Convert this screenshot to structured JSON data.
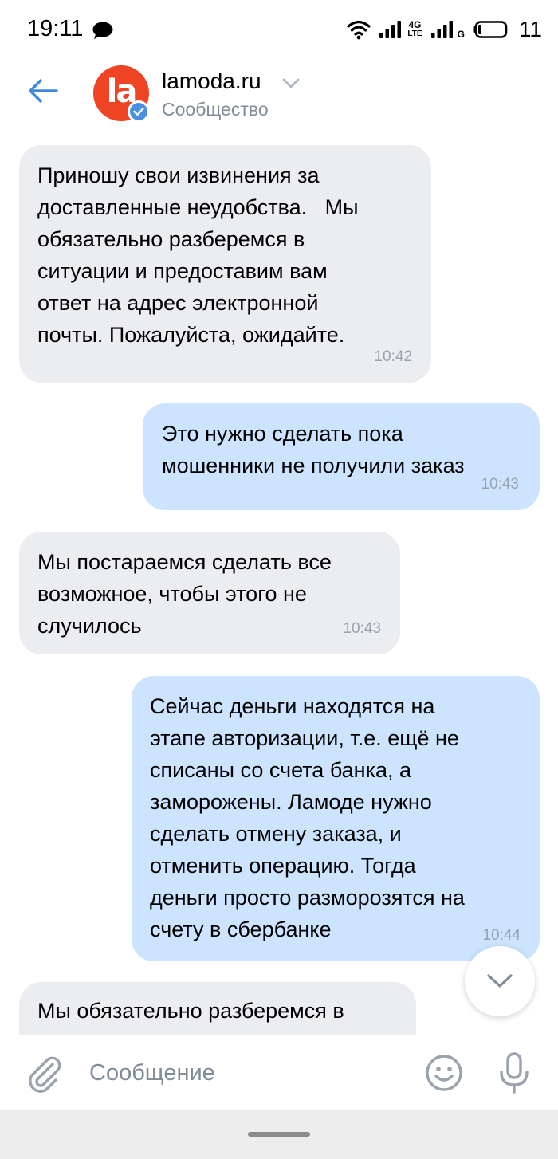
{
  "status_bar": {
    "time": "19:11",
    "network_1": "4G",
    "network_1_sub": "LTE",
    "network_2": "G",
    "battery": "11"
  },
  "header": {
    "avatar_text": "la",
    "title": "lamoda.ru",
    "subtitle": "Сообщество"
  },
  "messages": [
    {
      "direction": "in",
      "text": "Приношу свои извинения за\nдоставленные неудобства.   Мы\nобязательно разберемся в\nситуации и предоставим вам\nответ на адрес электронной\nпочты. Пожалуйста, ожидайте.",
      "time": "10:42"
    },
    {
      "direction": "out",
      "text": "Это нужно сделать пока\nмошенники не получили заказ",
      "time": "10:43"
    },
    {
      "direction": "in",
      "text": "Мы постараемся сделать все\nвозможное, чтобы этого не\nслучилось",
      "time": "10:43"
    },
    {
      "direction": "out",
      "text": "Сейчас деньги находятся на\nэтапе авторизации, т.е. ещё не\nсписаны со счета банка, а\nзаморожены. Ламоде нужно\nсделать отмену заказа, и\nотменить операцию. Тогда\nденьги просто разморозятся на\nсчету в сбербанке",
      "time": "10:44"
    },
    {
      "direction": "in",
      "text": "Мы обязательно разберемся в",
      "time": ""
    }
  ],
  "composer": {
    "placeholder": "Сообщение"
  },
  "colors": {
    "accent": "#3f8ae0",
    "brand": "#ef4423",
    "incoming_bubble": "#ebedf0",
    "outgoing_bubble": "#cce4ff"
  }
}
